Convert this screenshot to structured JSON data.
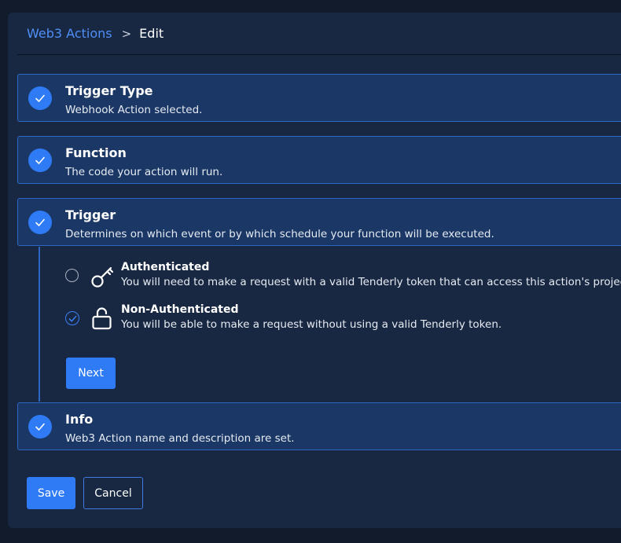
{
  "breadcrumb": {
    "parent": "Web3 Actions",
    "separator": ">",
    "current": "Edit"
  },
  "steps": [
    {
      "title": "Trigger Type",
      "subtitle": "Webhook Action selected."
    },
    {
      "title": "Function",
      "subtitle": "The code your action will run."
    },
    {
      "title": "Trigger",
      "subtitle": "Determines on which event or by which schedule your function will be executed."
    },
    {
      "title": "Info",
      "subtitle": "Web3 Action name and description are set."
    }
  ],
  "trigger_options": [
    {
      "title": "Authenticated",
      "description": "You will need to make a request with a valid Tenderly token that can access this action's project.",
      "selected": false,
      "icon": "key-icon"
    },
    {
      "title": "Non-Authenticated",
      "description": "You will be able to make a request without using a valid Tenderly token.",
      "selected": true,
      "icon": "unlock-icon"
    }
  ],
  "buttons": {
    "next": "Next",
    "save": "Save",
    "cancel": "Cancel"
  },
  "colors": {
    "accent": "#2f7bf5",
    "panel": "#182742",
    "step_bg": "#1a3766",
    "background": "#111b2b"
  }
}
